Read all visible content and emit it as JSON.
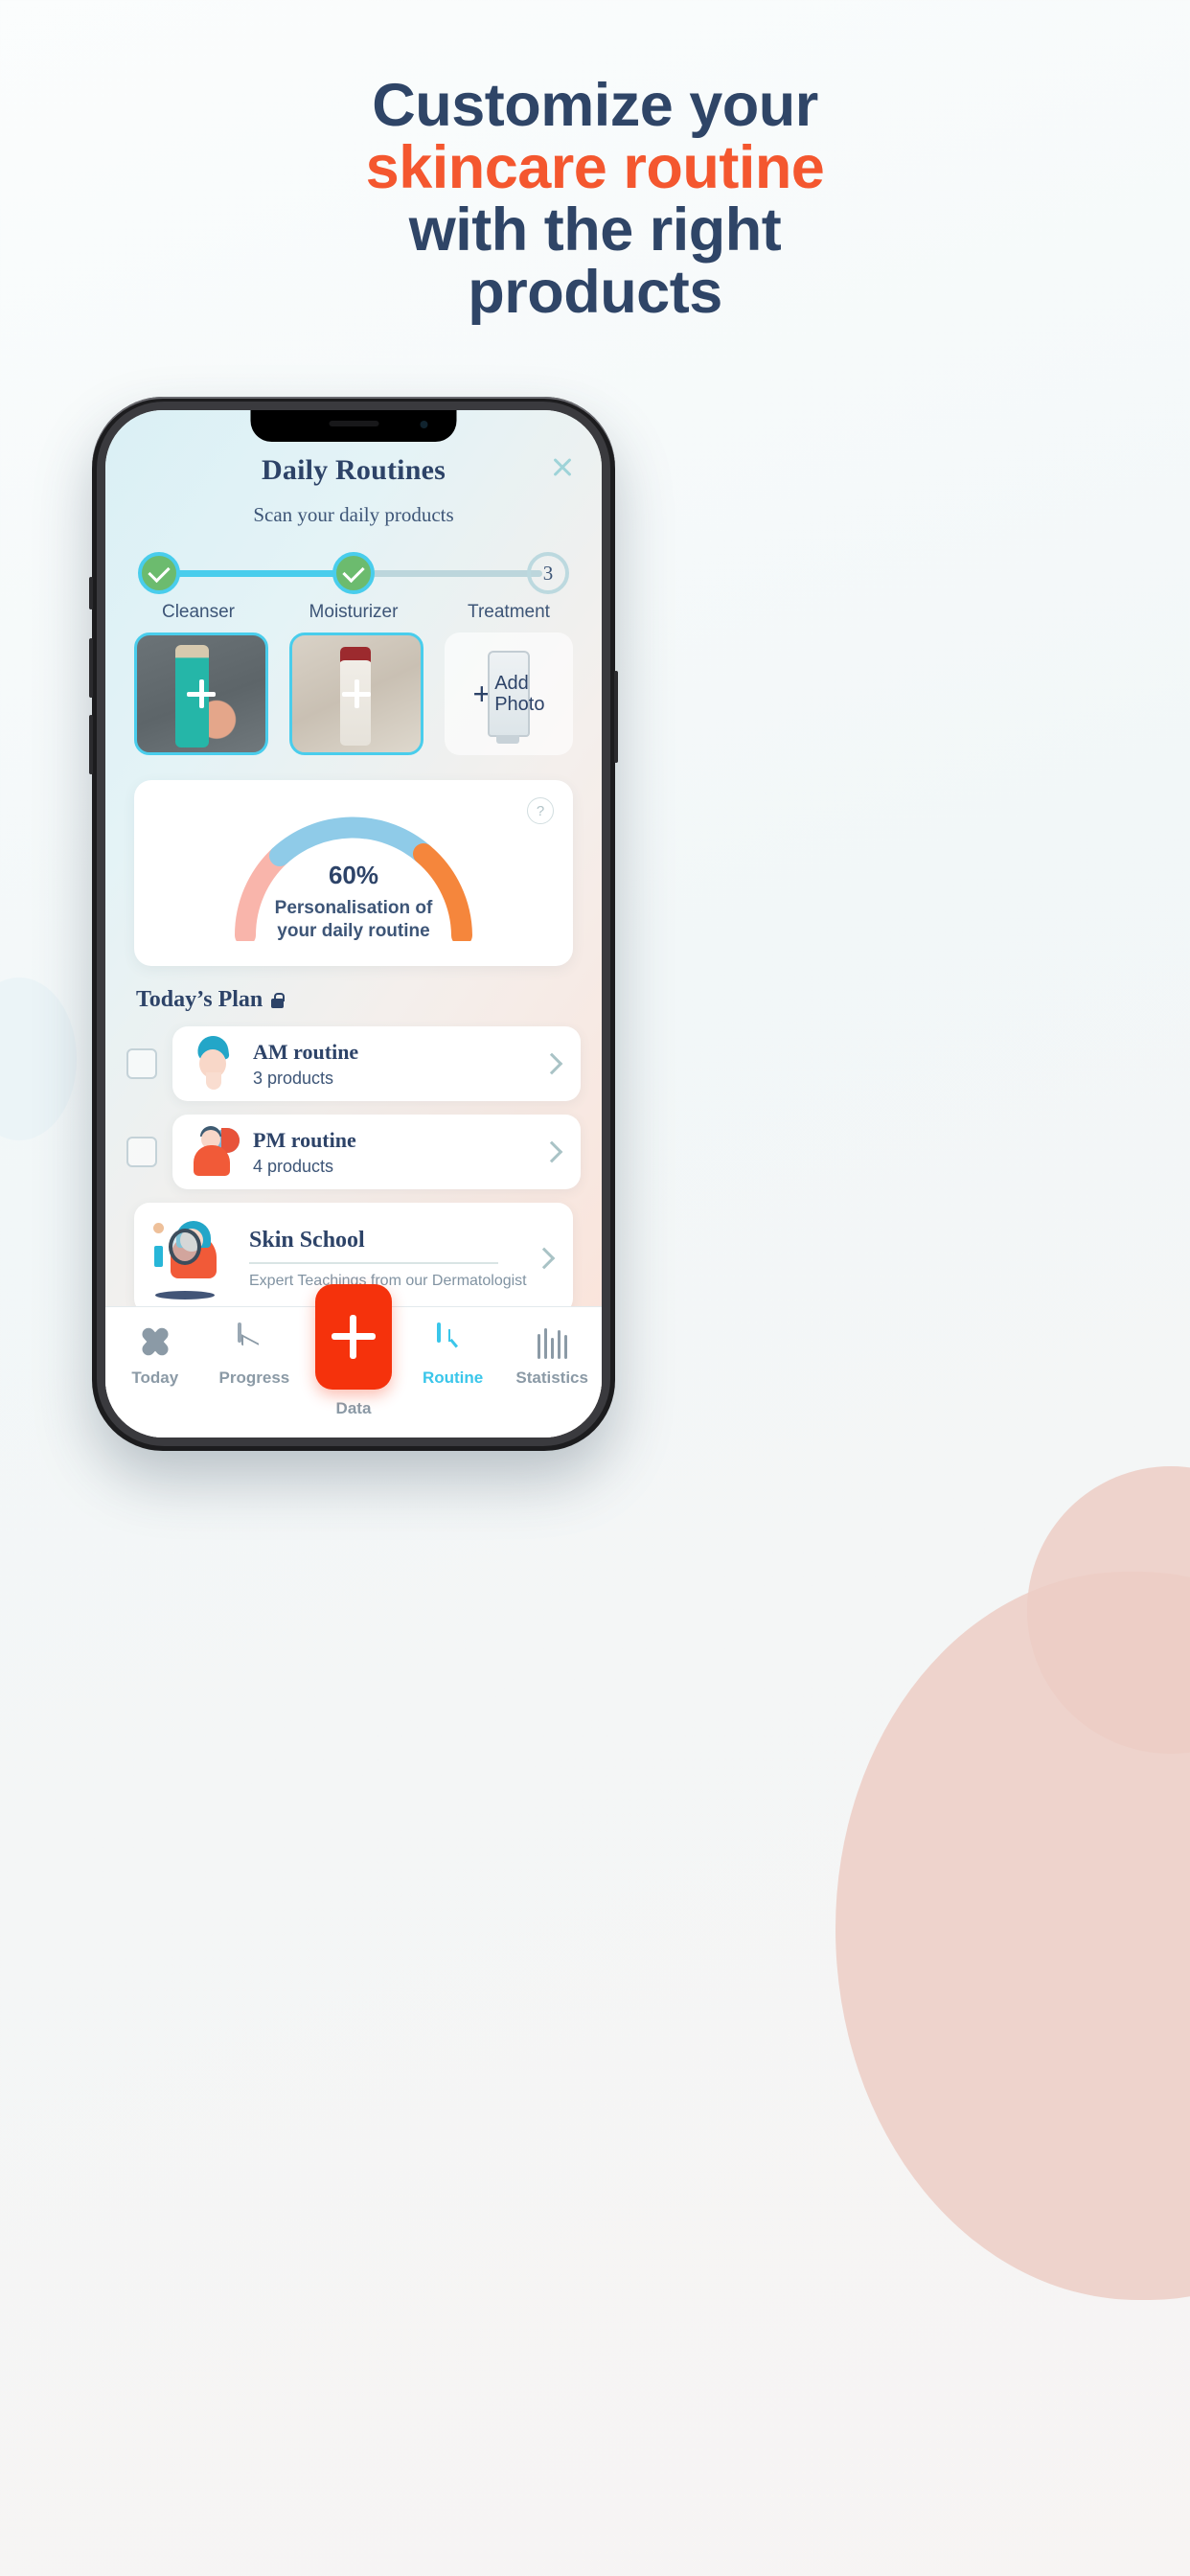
{
  "headline": {
    "line1": "Customize your",
    "line2": "skincare routine",
    "line3": "with the right",
    "line4": "products",
    "accent_color": "#f4572f",
    "text_color": "#2f4567"
  },
  "app": {
    "title": "Daily Routines",
    "subtitle": "Scan your daily products",
    "close_icon": "close-icon",
    "stepper": {
      "steps": [
        {
          "label": "Cleanser",
          "state": "done",
          "indicator": "check"
        },
        {
          "label": "Moisturizer",
          "state": "done",
          "indicator": "check"
        },
        {
          "label": "Treatment",
          "state": "todo",
          "indicator": "3"
        }
      ],
      "done_color": "#6cbb6e",
      "active_color": "#49cdec",
      "todo_color": "#bcd9df"
    },
    "products": [
      {
        "name": "cleanser-photo",
        "filled": true,
        "overlay_icon": "plus-icon"
      },
      {
        "name": "moisturizer-photo",
        "filled": true,
        "overlay_icon": "plus-icon"
      },
      {
        "name": "treatment-add-photo",
        "filled": false,
        "plus": "+",
        "label_line1": "Add",
        "label_line2": "Photo"
      }
    ],
    "gauge": {
      "help_icon": "?",
      "percent_label": "60%",
      "caption_line1": "Personalisation of",
      "caption_line2": "your daily routine"
    },
    "plan": {
      "heading": "Today’s Plan",
      "lock_icon": "lock-icon",
      "items": [
        {
          "title": "AM routine",
          "subtitle": "3 products",
          "checked": false
        },
        {
          "title": "PM routine",
          "subtitle": "4 products",
          "checked": false
        }
      ]
    },
    "skin_school": {
      "title": "Skin School",
      "subtitle": "Expert Teachings from our Dermatologist"
    },
    "tabs": [
      {
        "label": "Today",
        "icon": "flower-icon",
        "active": false
      },
      {
        "label": "Progress",
        "icon": "chart-icon",
        "active": false
      },
      {
        "label": "Data",
        "icon": "plus-icon",
        "active": false
      },
      {
        "label": "Routine",
        "icon": "clock-icon",
        "active": true
      },
      {
        "label": "Statistics",
        "icon": "bars-icon",
        "active": false
      }
    ]
  },
  "chart_data": {
    "type": "pie",
    "title": "Personalisation of your daily routine",
    "values": [
      60
    ],
    "categories": [
      "Personalisation"
    ],
    "value_label": "60%",
    "ylim": [
      0,
      100
    ],
    "segments": [
      {
        "name": "segment-pink",
        "color": "#f9b5ab",
        "from_pct": 0,
        "to_pct": 22
      },
      {
        "name": "segment-blue",
        "color": "#8fcbe8",
        "from_pct": 22,
        "to_pct": 62
      },
      {
        "name": "segment-orange",
        "color": "#f5863c",
        "from_pct": 62,
        "to_pct": 100
      }
    ]
  }
}
